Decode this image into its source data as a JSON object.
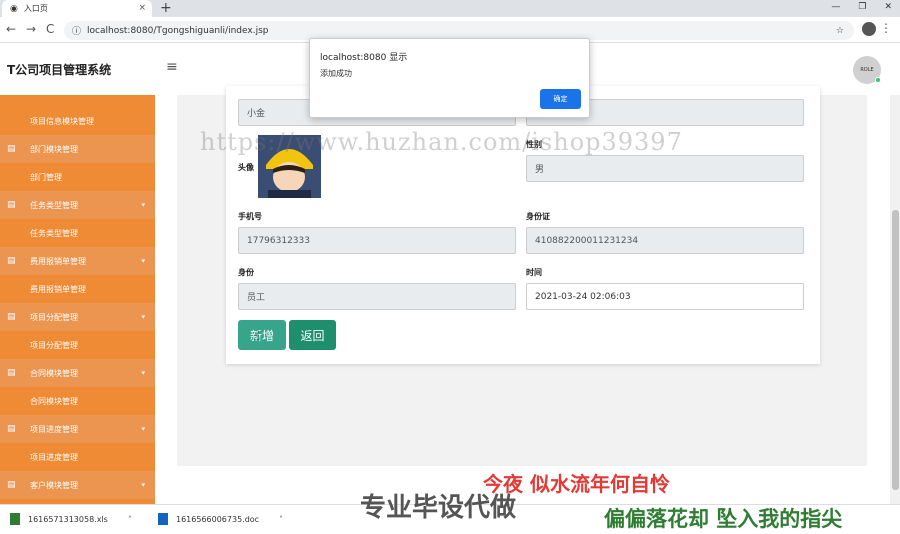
{
  "browser": {
    "tab_title": "入口页",
    "new_tab": "+",
    "url": "localhost:8080/Tgongshiguanli/index.jsp",
    "back": "←",
    "forward": "→",
    "reload": "C",
    "lock": "ⓘ",
    "star": "☆",
    "more": "⋮",
    "win_min": "—",
    "win_max": "❐",
    "win_close": "✕",
    "tab_close": "×"
  },
  "app": {
    "title": "T公司项目管理系统",
    "menu_icon": "≡",
    "avatar_text": "ROLE"
  },
  "sidebar": {
    "items": [
      {
        "type": "child",
        "label": "项目信息模块管理"
      },
      {
        "type": "parent",
        "label": "部门模块管理",
        "icon": "▤",
        "caret": ""
      },
      {
        "type": "child",
        "label": "部门管理"
      },
      {
        "type": "parent",
        "label": "任务类型管理",
        "icon": "▤",
        "caret": "▾"
      },
      {
        "type": "child",
        "label": "任务类型管理"
      },
      {
        "type": "parent",
        "label": "费用报销单管理",
        "icon": "▤",
        "caret": "▾"
      },
      {
        "type": "child",
        "label": "费用报销单管理"
      },
      {
        "type": "parent",
        "label": "项目分配管理",
        "icon": "▤",
        "caret": "▾"
      },
      {
        "type": "child",
        "label": "项目分配管理"
      },
      {
        "type": "parent",
        "label": "合同模块管理",
        "icon": "▤",
        "caret": "▾"
      },
      {
        "type": "child",
        "label": "合同模块管理"
      },
      {
        "type": "parent",
        "label": "项目进度管理",
        "icon": "▤",
        "caret": "▾"
      },
      {
        "type": "child",
        "label": "项目进度管理"
      },
      {
        "type": "parent",
        "label": "客户模块管理",
        "icon": "▤",
        "caret": "▾"
      }
    ]
  },
  "form": {
    "name_value": "小金",
    "avatar_label": "头像",
    "gender_label": "性别",
    "gender_value": "男",
    "phone_label": "手机号",
    "phone_value": "17796312333",
    "idcard_label": "身份证",
    "idcard_value": "410882200011231234",
    "role_label": "身份",
    "role_value": "员工",
    "time_label": "时间",
    "time_value": "2021-03-24 02:06:03",
    "add_button": "新增",
    "back_button": "返回"
  },
  "dialog": {
    "title": "localhost:8080 显示",
    "message": "添加成功",
    "ok": "确定"
  },
  "downloads": [
    {
      "name": "1616571313058.xls"
    },
    {
      "name": "1616566006735.doc"
    }
  ],
  "overlay": {
    "watermark": "https://www.huzhan.com/ishop39397",
    "line1": "今夜 似水流年何自怜",
    "line2": "专业毕设代做",
    "line3": "偏偏落花却 坠入我的指尖"
  }
}
